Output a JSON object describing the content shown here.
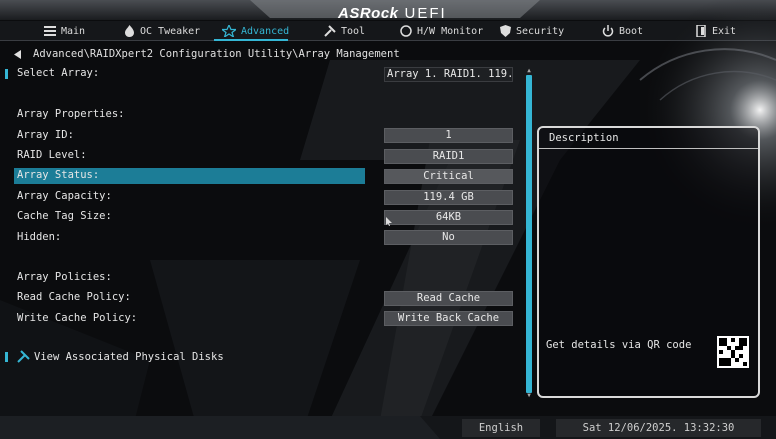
{
  "header": {
    "brand": "ASRock",
    "product": "UEFI"
  },
  "nav": [
    {
      "label": "Main",
      "icon": "grid-icon"
    },
    {
      "label": "OC Tweaker",
      "icon": "flame-icon"
    },
    {
      "label": "Advanced",
      "icon": "star-icon",
      "active": true
    },
    {
      "label": "Tool",
      "icon": "tools-icon"
    },
    {
      "label": "H/W Monitor",
      "icon": "monitor-icon"
    },
    {
      "label": "Security",
      "icon": "shield-icon"
    },
    {
      "label": "Boot",
      "icon": "power-icon"
    },
    {
      "label": "Exit",
      "icon": "exit-icon"
    }
  ],
  "breadcrumb": "Advanced\\RAIDXpert2 Configuration Utility\\Array Management",
  "settings": {
    "select_array": {
      "label": "Select Array:",
      "value": "Array 1. RAID1. 119.4..."
    },
    "properties_header": "Array Properties:",
    "array_id": {
      "label": "Array ID:",
      "value": "1"
    },
    "raid_level": {
      "label": "RAID Level:",
      "value": "RAID1"
    },
    "array_status": {
      "label": "Array Status:",
      "value": "Critical"
    },
    "array_capacity": {
      "label": "Array Capacity:",
      "value": "119.4 GB"
    },
    "cache_tag_size": {
      "label": "Cache Tag Size:",
      "value": "64KB"
    },
    "hidden": {
      "label": "Hidden:",
      "value": "No"
    },
    "policies_header": "Array Policies:",
    "read_cache_policy": {
      "label": "Read Cache Policy:",
      "value": "Read Cache"
    },
    "write_cache_policy": {
      "label": "Write Cache Policy:",
      "value": "Write Back Cache"
    },
    "view_disks": {
      "label": "View Associated Physical Disks"
    }
  },
  "description": {
    "title": "Description",
    "qr_text": "Get details via QR code"
  },
  "footer": {
    "language": "English",
    "datetime": "Sat 12/06/2025. 13:32:30"
  },
  "colors": {
    "accent": "#35b6d4",
    "highlight": "#1c7d97",
    "value_bg": "#4a4c50"
  }
}
